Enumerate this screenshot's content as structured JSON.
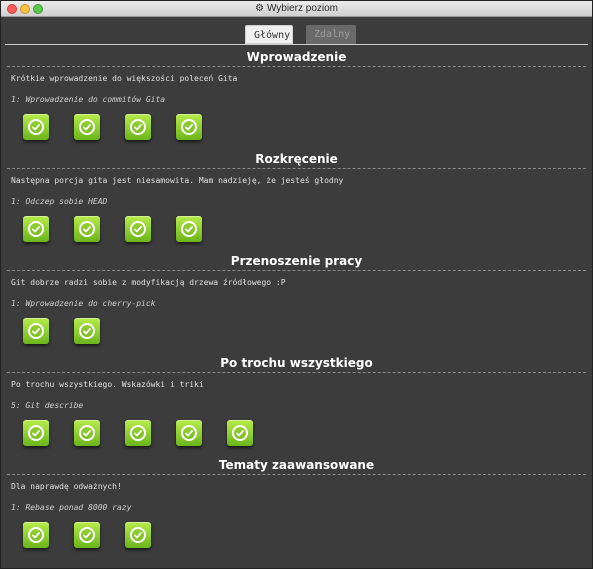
{
  "window": {
    "title": "Wybierz poziom",
    "title_icon": "gear-icon"
  },
  "tabs": [
    {
      "label": "Główny",
      "active": true
    },
    {
      "label": "Zdalny",
      "active": false
    }
  ],
  "sections": [
    {
      "title": "Wprowadzenie",
      "description": "Krótkie wprowadzenie do większości poleceń Gita",
      "level": "1: Wprowadzenie do commitów Gita",
      "completed_count": 4
    },
    {
      "title": "Rozkręcenie",
      "description": "Następna porcja gita jest niesamowita. Mam nadzieję, że jesteś głodny",
      "level": "1: Odczep sobie HEAD",
      "completed_count": 4
    },
    {
      "title": "Przenoszenie pracy",
      "description": "Git dobrze radzi sobie z modyfikacją drzewa źródłowego :P",
      "level": "1: Wprowadzenie do cherry-pick",
      "completed_count": 2
    },
    {
      "title": "Po trochu wszystkiego",
      "description": "Po trochu wszystkiego. Wskazówki i triki",
      "level": "5: Git describe",
      "completed_count": 5
    },
    {
      "title": "Tematy zaawansowane",
      "description": "Dla naprawdę odważnych!",
      "level": "1: Rebase ponad 8000 razy",
      "completed_count": 3
    }
  ],
  "colors": {
    "accent": "#8fd12e",
    "background": "#3c3c3c"
  }
}
